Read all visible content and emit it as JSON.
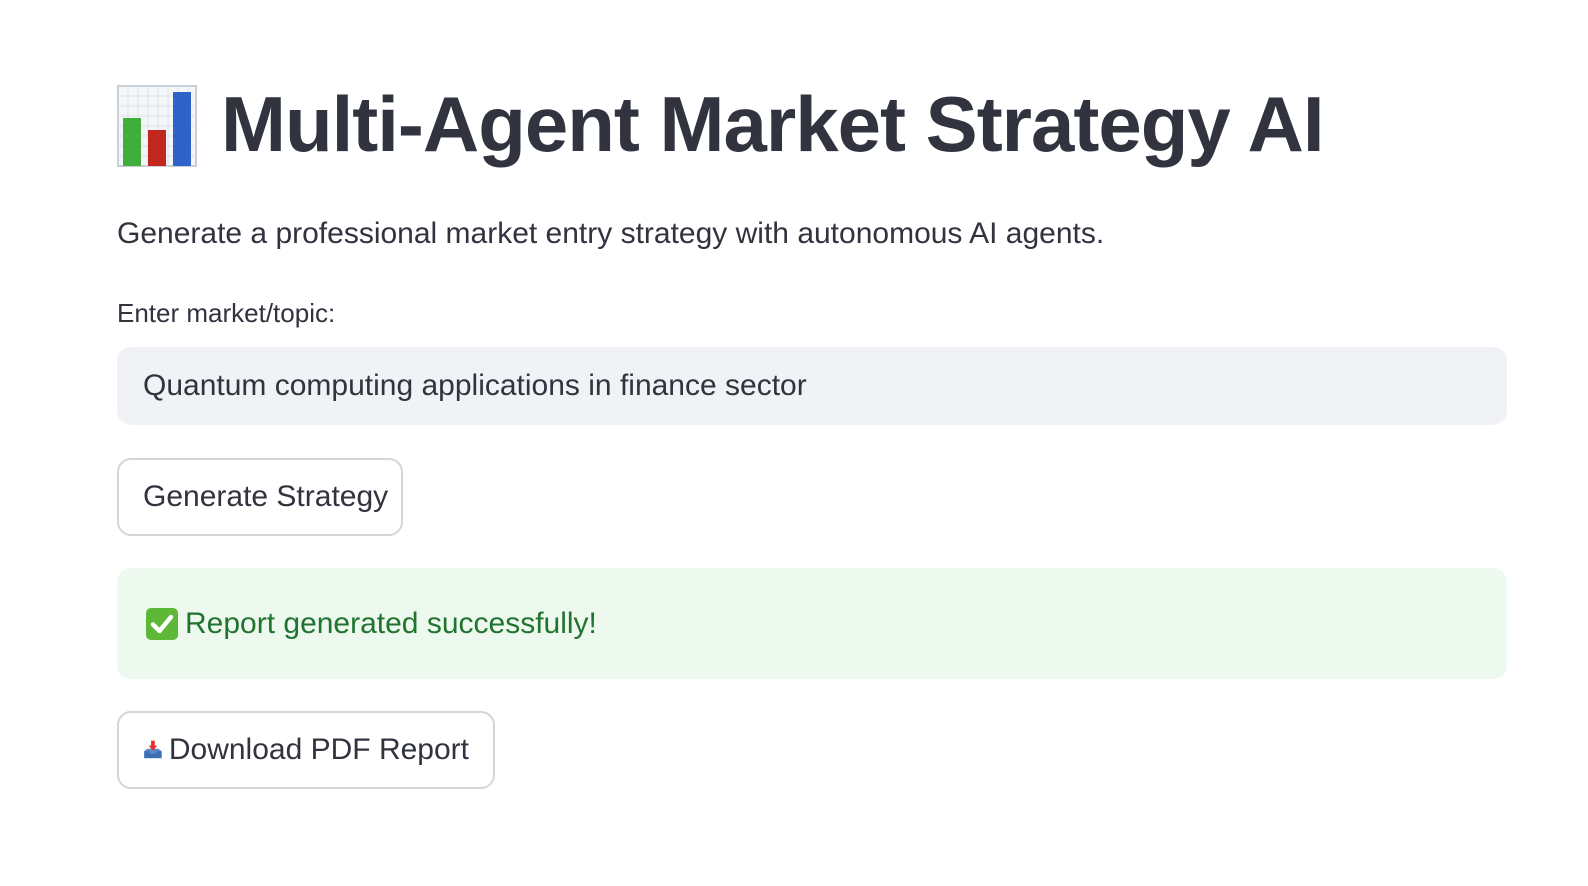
{
  "header": {
    "title": "Multi-Agent Market Strategy AI",
    "title_icon": "bar-chart-icon",
    "subtitle": "Generate a professional market entry strategy with autonomous AI agents."
  },
  "form": {
    "input_label": "Enter market/topic:",
    "input_value": "Quantum computing applications in finance sector",
    "generate_button_label": "Generate Strategy"
  },
  "status": {
    "icon": "check-mark-icon",
    "message": "Report generated successfully!"
  },
  "download": {
    "icon": "inbox-tray-icon",
    "button_label": "Download PDF Report"
  },
  "colors": {
    "text": "#31333f",
    "input_background": "#f0f2f6",
    "success_background": "#edf8ee",
    "success_text": "#21742f",
    "button_border": "#d6d6d9"
  }
}
